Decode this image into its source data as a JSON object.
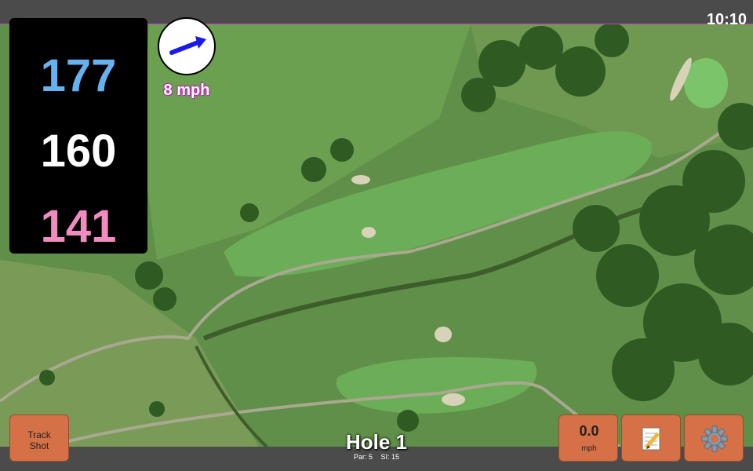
{
  "status_bar": {
    "time": "10:10"
  },
  "distances": {
    "back": "177",
    "middle": "160",
    "front": "141"
  },
  "wind": {
    "speed": "8 mph",
    "direction_icon": "arrow-right-icon",
    "arrow_color": "#1a1ae6"
  },
  "hole": {
    "title": "Hole 1",
    "par": "Par: 5",
    "stroke_index": "SI: 15"
  },
  "buttons": {
    "track_shot": "Track Shot",
    "speed_value": "0.0",
    "speed_unit": "mph",
    "notes_icon": "notepad-icon",
    "settings_icon": "gear-icon"
  },
  "colors": {
    "button_fill": "#d57047",
    "back_distance": "#66b2f0",
    "middle_distance": "#ffffff",
    "front_distance": "#f08cc0",
    "panel_bg": "#000000"
  }
}
